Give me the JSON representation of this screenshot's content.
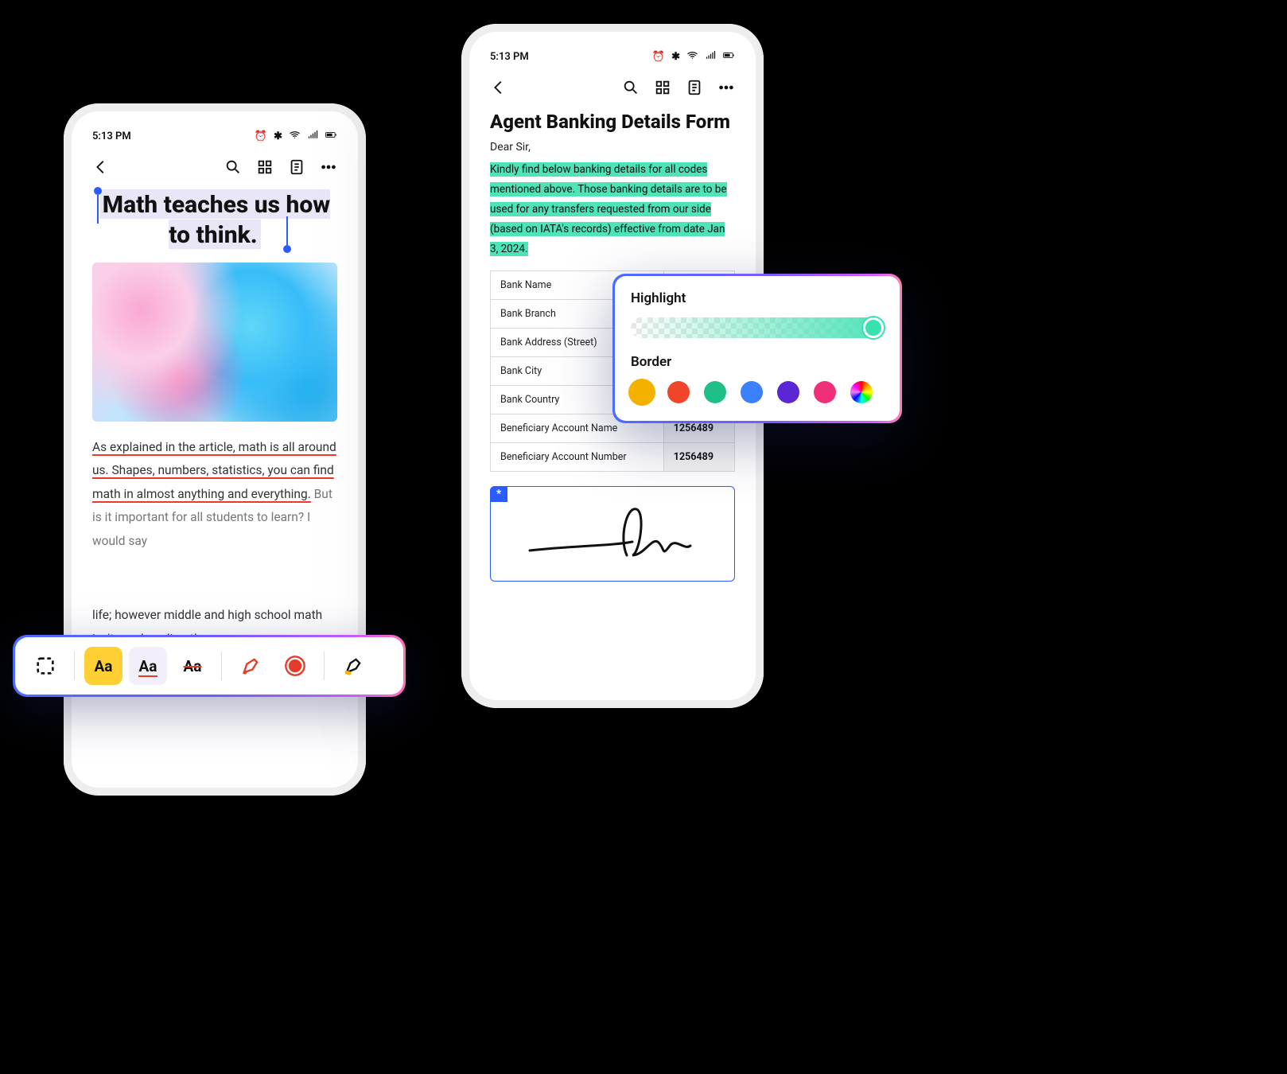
{
  "status": {
    "time": "5:13 PM"
  },
  "left_phone": {
    "heading": "Math teaches us how to think.",
    "paragraph_underlined": "As explained in the article, math is all around us. Shapes, numbers, statistics, you can find math in almost anything and everything.",
    "paragraph_rest_1": " But is it important for all students to learn? I would say",
    "paragraph_rest_2": "life; however middle and high school math isn't used as directly...."
  },
  "right_phone": {
    "title": "Agent Banking Details Form",
    "greeting": "Dear Sir,",
    "highlighted_paragraph": "Kindly find below banking details for all codes mentioned above. Those banking details are to be used for any transfers requested from our side (based on IATA's records) effective from date Jan 3, 2024.",
    "table_rows": [
      {
        "label": "Bank Name",
        "value": ""
      },
      {
        "label": "Bank Branch",
        "value": ""
      },
      {
        "label": "Bank Address (Street)",
        "value": ""
      },
      {
        "label": "Bank City",
        "value": ""
      },
      {
        "label": "Bank Country",
        "value": ""
      },
      {
        "label": "Beneficiary Account Name",
        "value": "1256489"
      },
      {
        "label": "Beneficiary Account Number",
        "value": "1256489"
      }
    ],
    "signature_marker": "*"
  },
  "toolbar": {
    "highlight_label": "Aa",
    "underline_label": "Aa",
    "strike_label": "Aa"
  },
  "hl_panel": {
    "highlight_label": "Highlight",
    "border_label": "Border",
    "colors": [
      "#f5b100",
      "#f0452a",
      "#1fbf88",
      "#3a80ff",
      "#5b26d6",
      "#ef2f78",
      "rainbow"
    ],
    "selected_color_index": 0
  }
}
